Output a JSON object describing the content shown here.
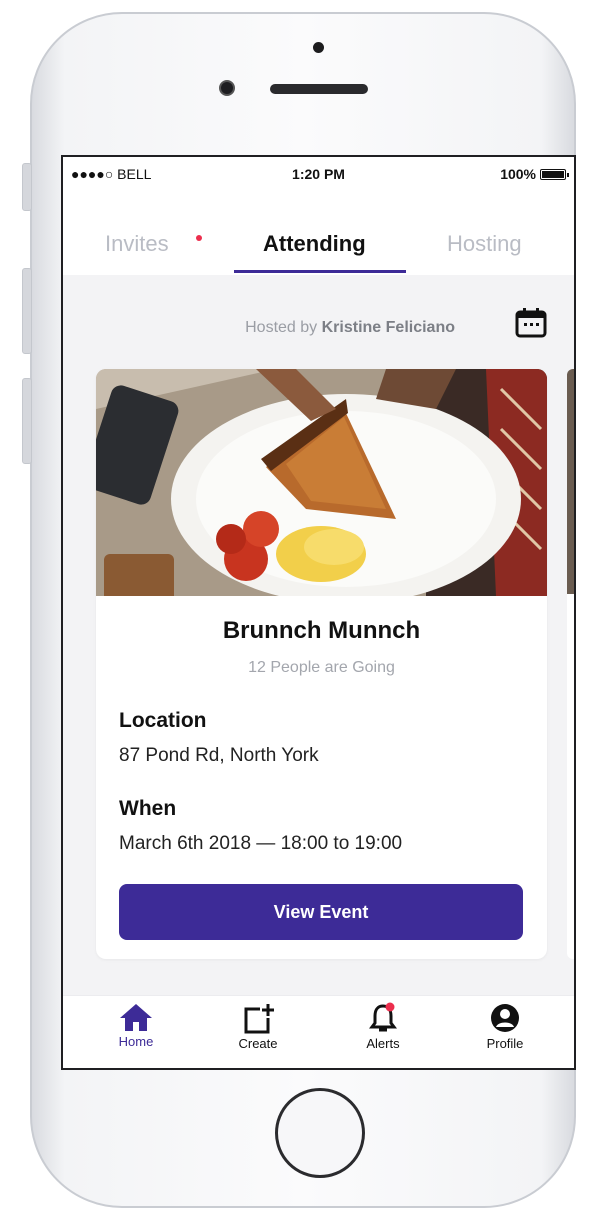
{
  "status_bar": {
    "carrier": "●●●●○ BELL",
    "time": "1:20 PM",
    "battery": "100%"
  },
  "tabs": [
    {
      "label": "Invites",
      "has_notification": true
    },
    {
      "label": "Attending",
      "active": true
    },
    {
      "label": "Hosting"
    }
  ],
  "host": {
    "prefix": "Hosted by",
    "name": "Kristine Feliciano"
  },
  "event": {
    "title": "Brunnch Munnch",
    "going": "12 People are Going",
    "location_label": "Location",
    "location": "87 Pond Rd, North York",
    "when_label": "When",
    "when": "March 6th 2018 — 18:00 to 19:00",
    "button": "View Event"
  },
  "tab_bar": [
    {
      "label": "Home",
      "icon": "home-icon",
      "active": true
    },
    {
      "label": "Create",
      "icon": "create-icon"
    },
    {
      "label": "Alerts",
      "icon": "bell-icon",
      "has_notification": true
    },
    {
      "label": "Profile",
      "icon": "profile-icon"
    }
  ],
  "colors": {
    "accent": "#3d2b97",
    "notification": "#ec2e4d",
    "inactive_tab": "#b9bcc4"
  }
}
